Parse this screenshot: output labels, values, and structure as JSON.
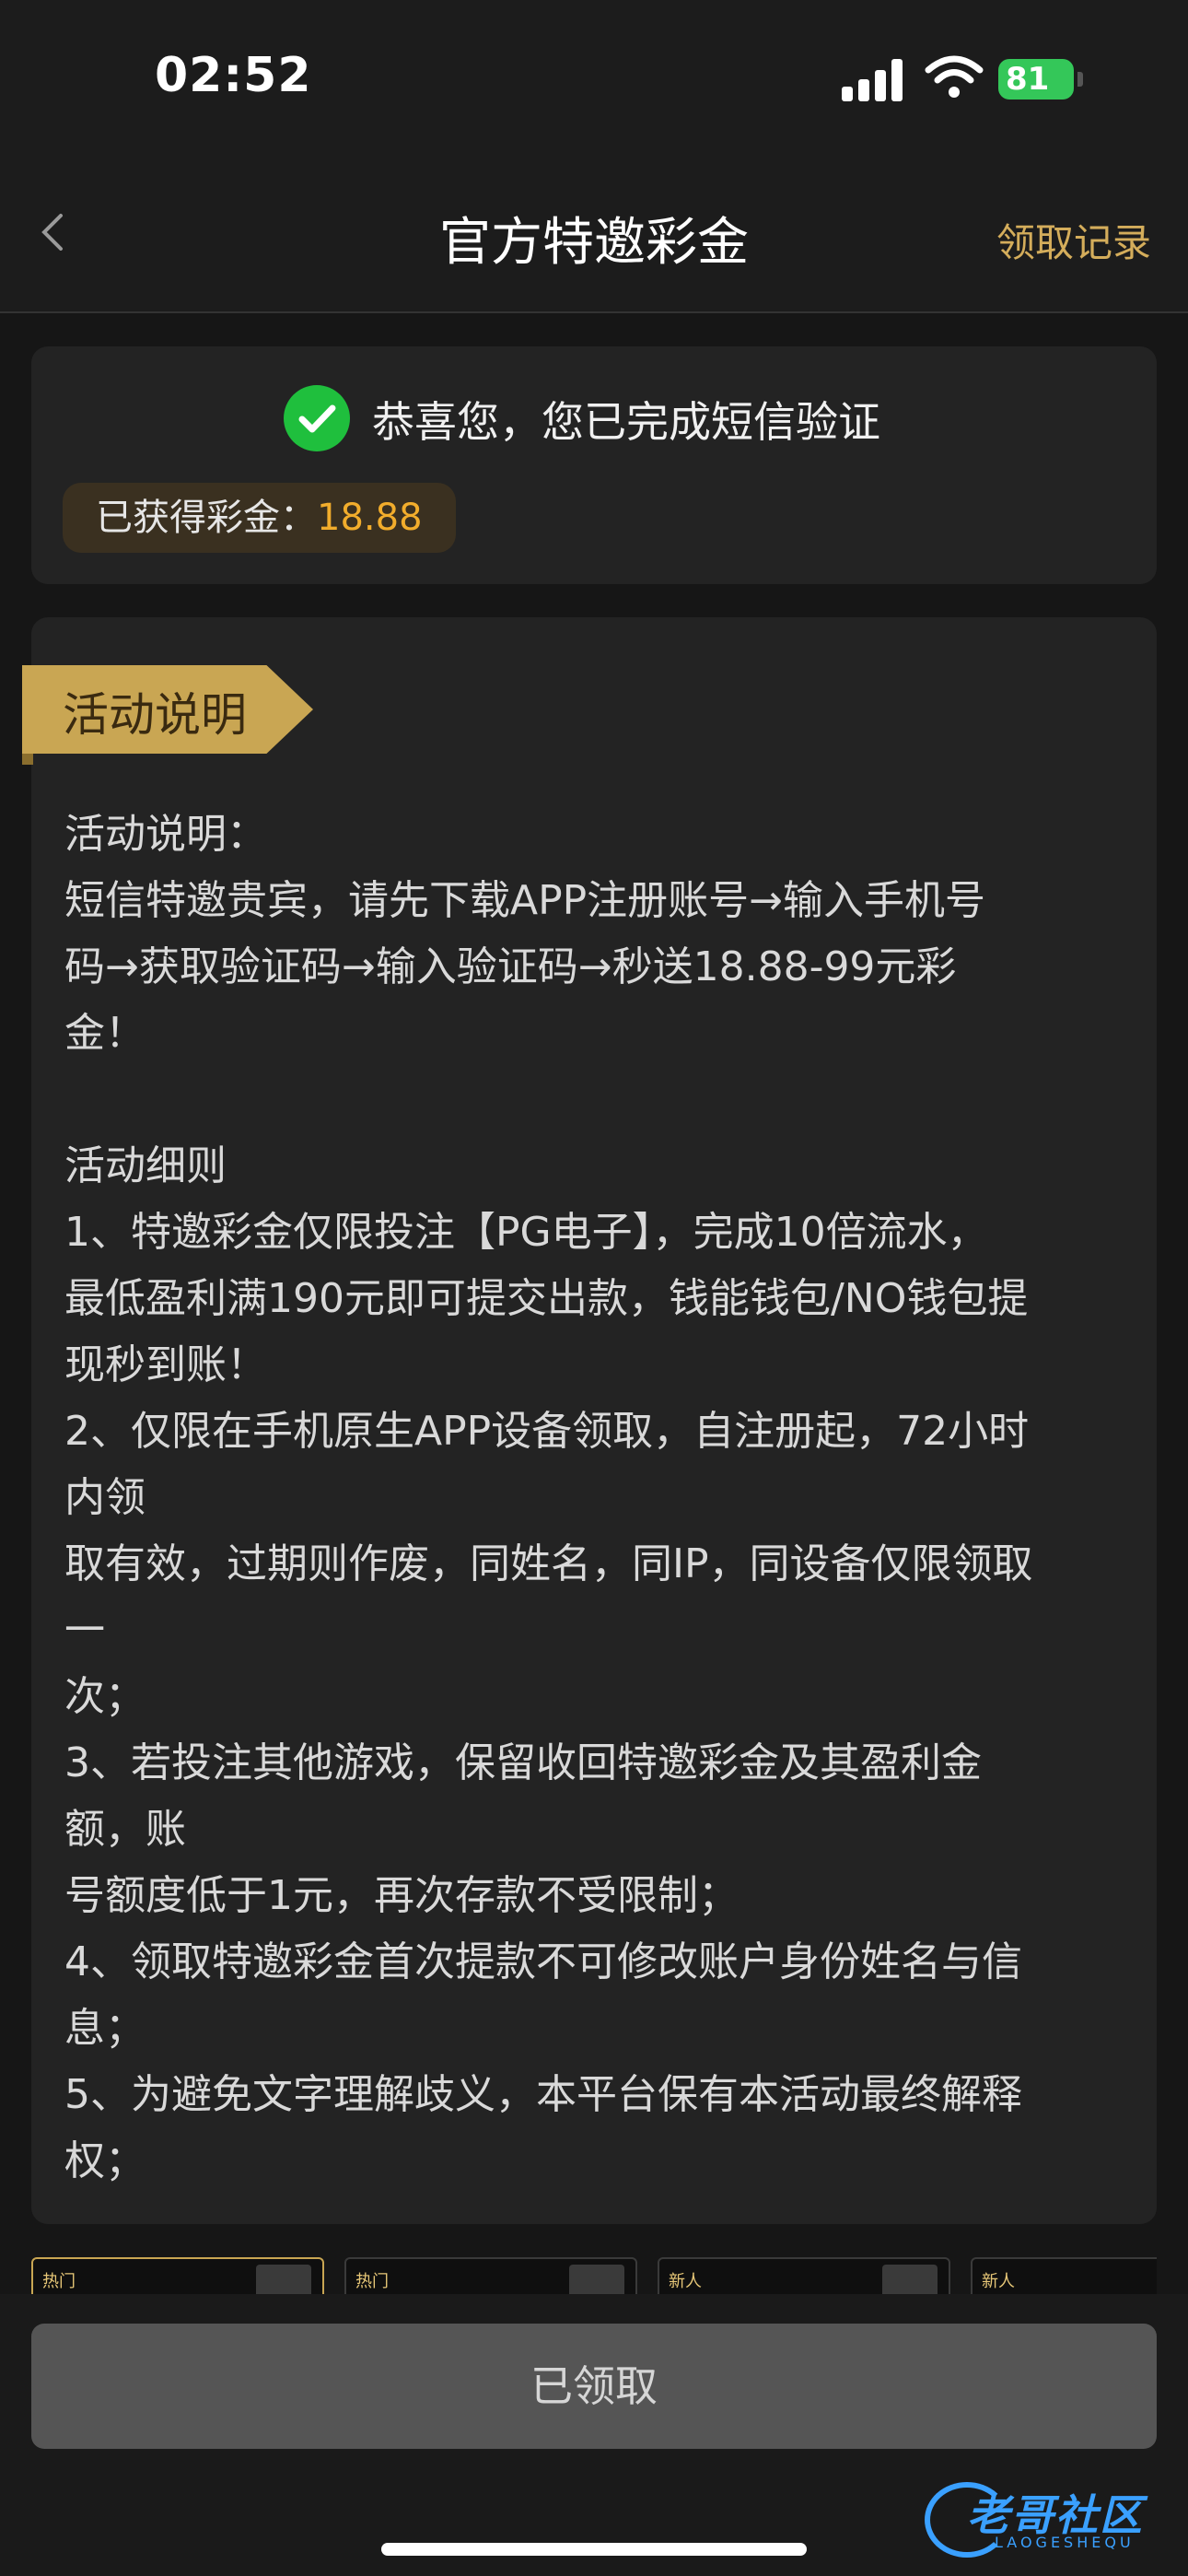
{
  "status_bar": {
    "time": "02:52",
    "battery": "81"
  },
  "header": {
    "title": "官方特邀彩金",
    "records_link": "领取记录"
  },
  "verify_card": {
    "message": "恭喜您，您已完成短信验证",
    "bonus_label": "已获得彩金：",
    "bonus_value": "18.88"
  },
  "rules_card": {
    "ribbon_label": "活动说明",
    "content": "活动说明：\n短信特邀贵宾，请先下载APP注册账号→输入手机号\n码→获取验证码→输入验证码→秒送18.88-99元彩\n金！\n\n活动细则\n1、特邀彩金仅限投注【PG电子】，完成10倍流水，\n最低盈利满190元即可提交出款，钱能钱包/NO钱包提\n现秒到账！\n2、仅限在手机原生APP设备领取，自注册起，72小时\n内领\n取有效，过期则作废，同姓名，同IP，同设备仅限领取\n一\n次；\n3、若投注其他游戏，保留收回特邀彩金及其盈利金\n额，账\n号额度低于1元，再次存款不受限制；\n4、领取特邀彩金首次提款不可修改账户身份姓名与信\n息；\n5、为避免文字理解歧义，本平台保有本活动最终解释\n权；"
  },
  "game_strip": {
    "items": [
      {
        "tag": "热门"
      },
      {
        "tag": "热门"
      },
      {
        "tag": "新人"
      },
      {
        "tag": "新人"
      }
    ]
  },
  "bottom": {
    "button_label": "已领取"
  },
  "watermark": {
    "text": "老哥社区",
    "sub": "LAOGESHEQU"
  },
  "colors": {
    "gold": "#d4ad5b",
    "accent_orange": "#f2ad2c",
    "success_green": "#1fbf3d"
  }
}
